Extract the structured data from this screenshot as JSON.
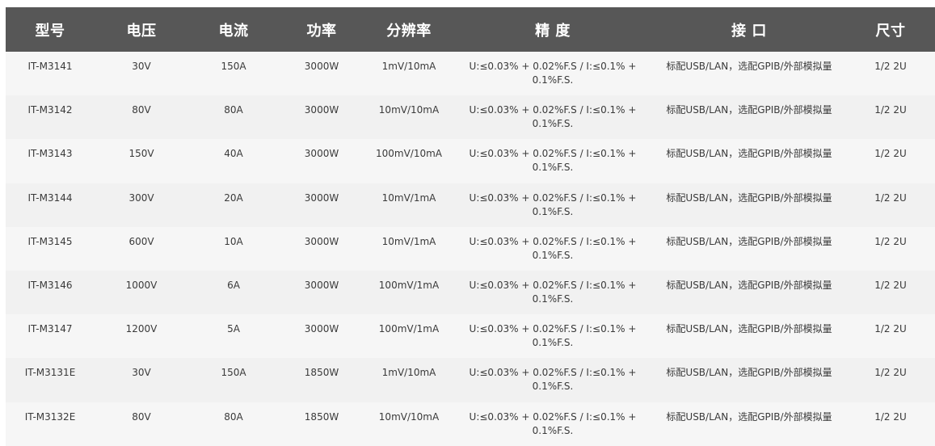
{
  "table": {
    "headers": [
      "型号",
      "电压",
      "电流",
      "功率",
      "分辨率",
      "精 度",
      "接 口",
      "尺寸"
    ],
    "rows": [
      [
        "IT-M3141",
        "30V",
        "150A",
        "3000W",
        "1mV/10mA",
        "U:≤0.03% + 0.02%F.S / I:≤0.1% + 0.1%F.S.",
        "标配USB/LAN，选配GPIB/外部模拟量",
        "1/2 2U"
      ],
      [
        "IT-M3142",
        "80V",
        "80A",
        "3000W",
        "10mV/10mA",
        "U:≤0.03% + 0.02%F.S / I:≤0.1% + 0.1%F.S.",
        "标配USB/LAN，选配GPIB/外部模拟量",
        "1/2 2U"
      ],
      [
        "IT-M3143",
        "150V",
        "40A",
        "3000W",
        "100mV/10mA",
        "U:≤0.03% + 0.02%F.S / I:≤0.1% + 0.1%F.S.",
        "标配USB/LAN，选配GPIB/外部模拟量",
        "1/2 2U"
      ],
      [
        "IT-M3144",
        "300V",
        "20A",
        "3000W",
        "10mV/1mA",
        "U:≤0.03% + 0.02%F.S / I:≤0.1% + 0.1%F.S.",
        "标配USB/LAN，选配GPIB/外部模拟量",
        "1/2 2U"
      ],
      [
        "IT-M3145",
        "600V",
        "10A",
        "3000W",
        "10mV/1mA",
        "U:≤0.03% + 0.02%F.S / I:≤0.1% + 0.1%F.S.",
        "标配USB/LAN，选配GPIB/外部模拟量",
        "1/2 2U"
      ],
      [
        "IT-M3146",
        "1000V",
        "6A",
        "3000W",
        "100mV/1mA",
        "U:≤0.03% + 0.02%F.S / I:≤0.1% + 0.1%F.S.",
        "标配USB/LAN，选配GPIB/外部模拟量",
        "1/2 2U"
      ],
      [
        "IT-M3147",
        "1200V",
        "5A",
        "3000W",
        "100mV/1mA",
        "U:≤0.03% + 0.02%F.S / I:≤0.1% + 0.1%F.S.",
        "标配USB/LAN，选配GPIB/外部模拟量",
        "1/2 2U"
      ],
      [
        "IT-M3131E",
        "30V",
        "150A",
        "1850W",
        "1mV/10mA",
        "U:≤0.03% + 0.02%F.S / I:≤0.1% + 0.1%F.S.",
        "标配USB/LAN，选配GPIB/外部模拟量",
        "1/2 2U"
      ],
      [
        "IT-M3132E",
        "80V",
        "80A",
        "1850W",
        "10mV/10mA",
        "U:≤0.03% + 0.02%F.S / I:≤0.1% + 0.1%F.S.",
        "标配USB/LAN，选配GPIB/外部模拟量",
        "1/2 2U"
      ]
    ]
  }
}
